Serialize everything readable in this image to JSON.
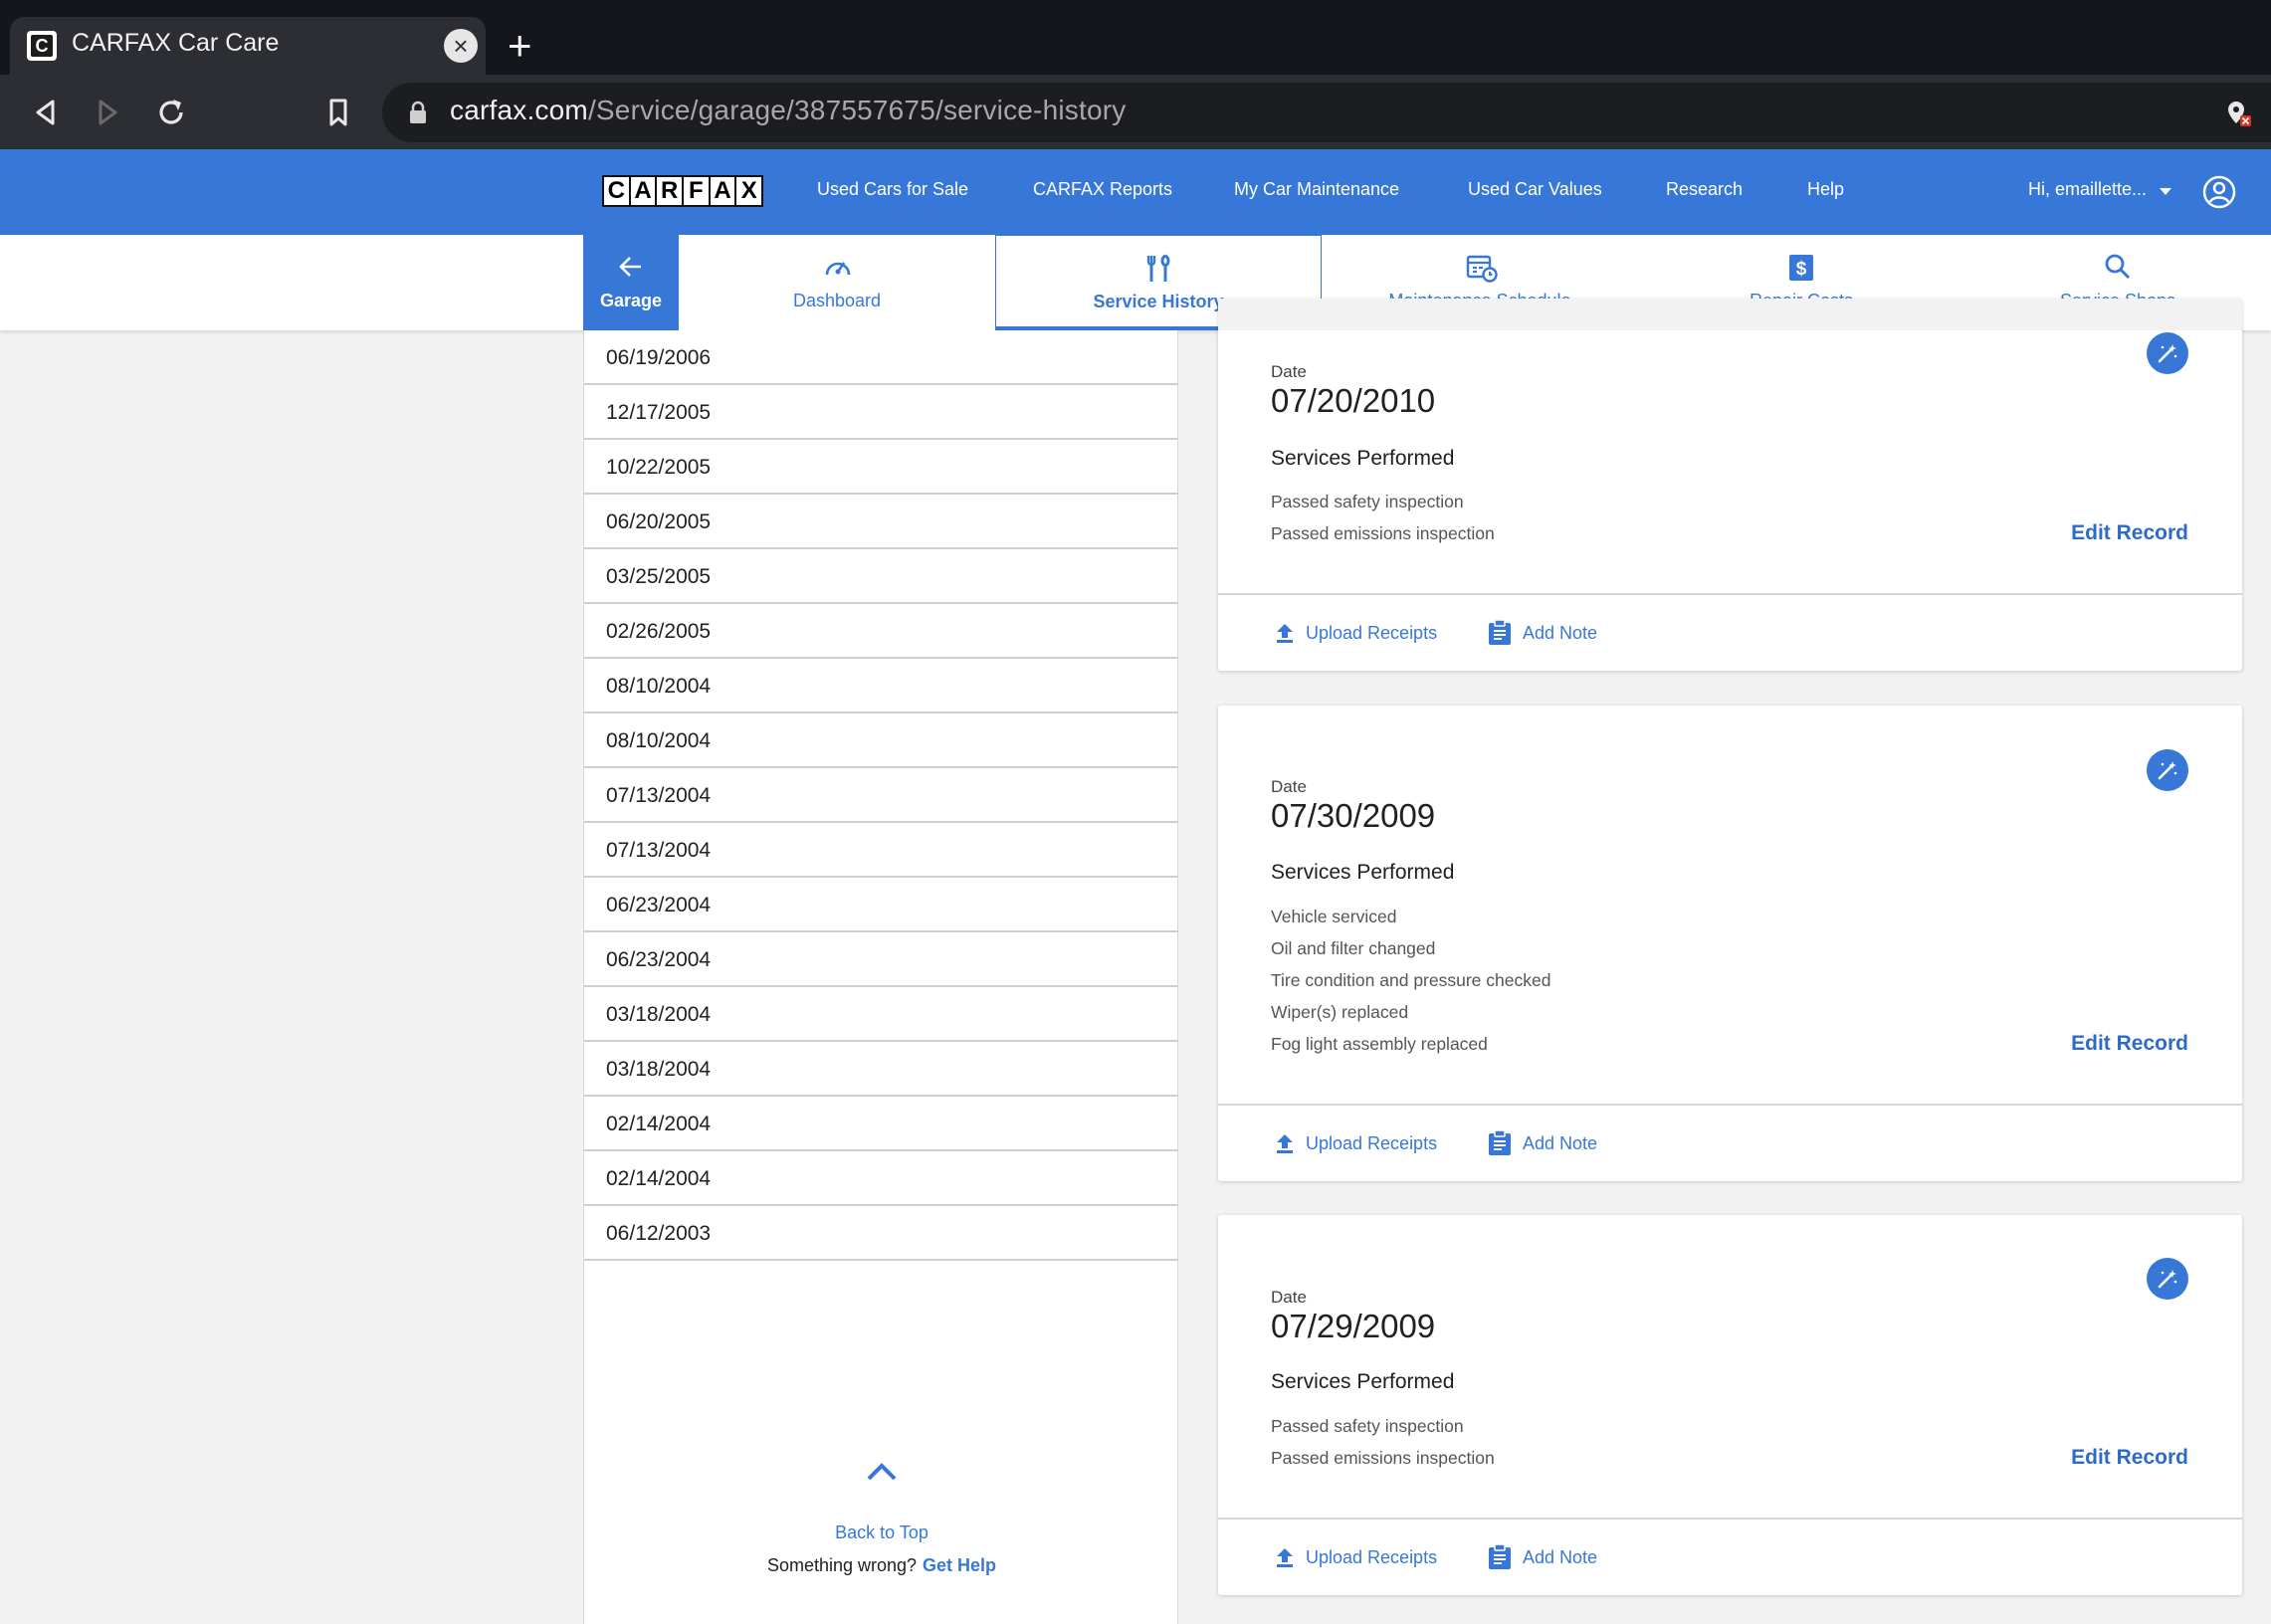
{
  "browser": {
    "tab_title": "CARFAX Car Care",
    "url_host": "carfax.com",
    "url_path": "/Service/garage/387557675/service-history"
  },
  "header": {
    "logo_letters": [
      "C",
      "A",
      "R",
      "F",
      "A",
      "X"
    ],
    "nav": [
      "Used Cars for Sale",
      "CARFAX Reports",
      "My Car Maintenance",
      "Used Car Values",
      "Research",
      "Help"
    ],
    "user_greeting": "Hi, emaillette...",
    "brand_color": "#3777d8"
  },
  "subnav": {
    "garage": "Garage",
    "tabs": [
      "Dashboard",
      "Service History",
      "Maintenance Schedule",
      "Repair Costs",
      "Service Shops"
    ],
    "active_tab": "Service History"
  },
  "date_list": [
    "06/19/2006",
    "12/17/2005",
    "10/22/2005",
    "06/20/2005",
    "03/25/2005",
    "02/26/2005",
    "08/10/2004",
    "08/10/2004",
    "07/13/2004",
    "07/13/2004",
    "06/23/2004",
    "06/23/2004",
    "03/18/2004",
    "03/18/2004",
    "02/14/2004",
    "02/14/2004",
    "06/12/2003"
  ],
  "footer": {
    "back_to_top": "Back to Top",
    "something_wrong": "Something wrong?",
    "get_help": "Get Help"
  },
  "records": [
    {
      "date_label": "Date",
      "date": "07/20/2010",
      "services_title": "Services Performed",
      "services": [
        "Passed safety inspection",
        "Passed emissions inspection"
      ],
      "edit": "Edit Record",
      "upload": "Upload Receipts",
      "note": "Add Note"
    },
    {
      "date_label": "Date",
      "date": "07/30/2009",
      "services_title": "Services Performed",
      "services": [
        "Vehicle serviced",
        "Oil and filter changed",
        "Tire condition and pressure checked",
        "Wiper(s) replaced",
        "Fog light assembly replaced"
      ],
      "edit": "Edit Record",
      "upload": "Upload Receipts",
      "note": "Add Note"
    },
    {
      "date_label": "Date",
      "date": "07/29/2009",
      "services_title": "Services Performed",
      "services": [
        "Passed safety inspection",
        "Passed emissions inspection"
      ],
      "edit": "Edit Record",
      "upload": "Upload Receipts",
      "note": "Add Note"
    }
  ]
}
